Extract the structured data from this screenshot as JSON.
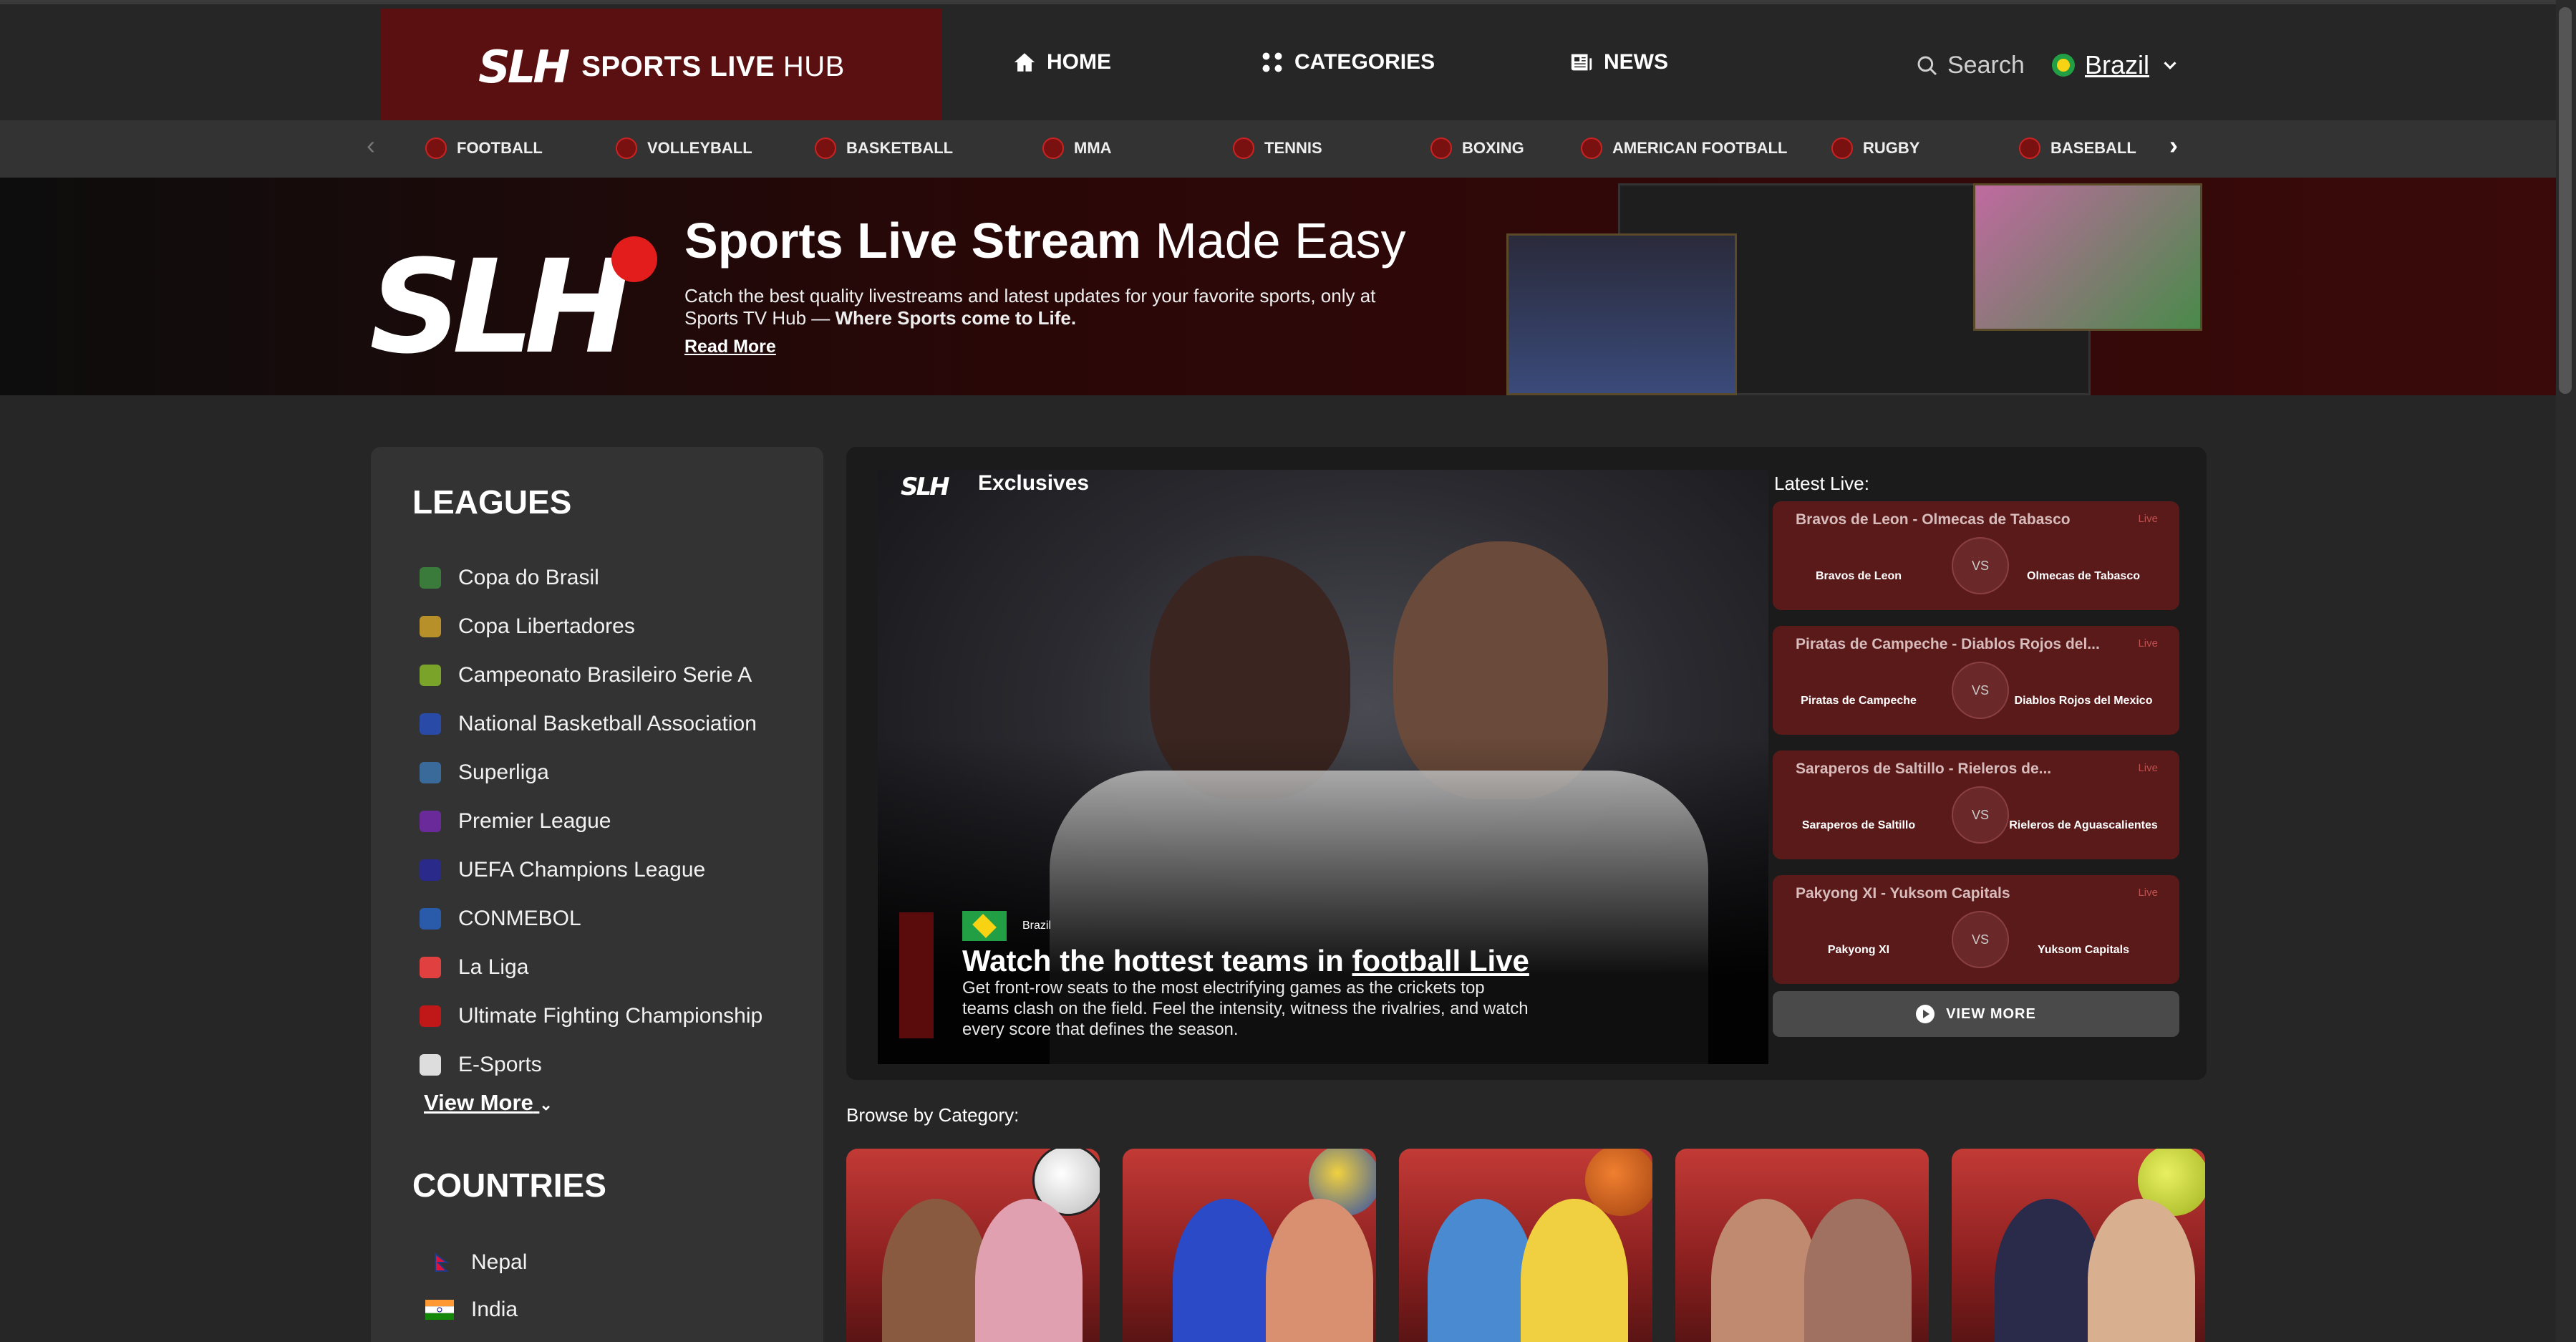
{
  "header": {
    "logo_mark": "SLH",
    "logo_brand": "SPORTS LIVE",
    "logo_brand_light": "HUB",
    "nav": [
      {
        "label": "HOME",
        "icon": "home-icon"
      },
      {
        "label": "CATEGORIES",
        "icon": "grid-icon"
      },
      {
        "label": "NEWS",
        "icon": "newspaper-icon"
      }
    ],
    "search_label": "Search",
    "country": "Brazil"
  },
  "sports": [
    "FOOTBALL",
    "VOLLEYBALL",
    "BASKETBALL",
    "MMA",
    "TENNIS",
    "BOXING",
    "AMERICAN FOOTBALL",
    "RUGBY",
    "BASEBALL"
  ],
  "banner": {
    "title_bold": "Sports Live Stream",
    "title_light": "Made Easy",
    "desc": "Catch the best quality livestreams and latest updates for your favorite sports, only at Sports TV Hub —",
    "desc_bold": "Where Sports come to Life.",
    "link": "Read More"
  },
  "sidebar": {
    "leagues_heading": "LEAGUES",
    "leagues": [
      {
        "name": "Copa do Brasil",
        "color": "#3a7a3a"
      },
      {
        "name": "Copa Libertadores",
        "color": "#b8902a"
      },
      {
        "name": "Campeonato Brasileiro Serie A",
        "color": "#7aa32a"
      },
      {
        "name": "National Basketball Association",
        "color": "#2a4aa8"
      },
      {
        "name": "Superliga",
        "color": "#3a6a9a"
      },
      {
        "name": "Premier League",
        "color": "#6a2a9a"
      },
      {
        "name": "UEFA Champions League",
        "color": "#2a2a8a"
      },
      {
        "name": "CONMEBOL",
        "color": "#2a5aaa"
      },
      {
        "name": "La Liga",
        "color": "#e04040"
      },
      {
        "name": "Ultimate Fighting Championship",
        "color": "#c01818"
      },
      {
        "name": "E-Sports",
        "color": "#dddddd"
      }
    ],
    "view_more": "View More",
    "countries_heading": "COUNTRIES",
    "countries": [
      "Nepal",
      "India"
    ]
  },
  "exclusives": {
    "logo": "SLH",
    "label": "Exclusives",
    "country": "Brazil",
    "title_prefix": "Watch the hottest teams in",
    "title_link": "football Live",
    "desc": "Get front-row seats to the most electrifying games as the crickets top teams clash on the field. Feel the intensity, witness the rivalries, and watch every score that defines the season."
  },
  "latest": {
    "label": "Latest Live:",
    "live_tag": "Live",
    "vs": "VS",
    "matches": [
      {
        "title": "Bravos de Leon - Olmecas de Tabasco",
        "team1": "Bravos de Leon",
        "team2": "Olmecas de Tabasco"
      },
      {
        "title": "Piratas de Campeche - Diablos Rojos del...",
        "team1": "Piratas de Campeche",
        "team2": "Diablos Rojos del Mexico"
      },
      {
        "title": "Saraperos de Saltillo - Rieleros de...",
        "team1": "Saraperos de Saltillo",
        "team2": "Rieleros de Aguascalientes"
      },
      {
        "title": "Pakyong XI - Yuksom Capitals",
        "team1": "Pakyong XI",
        "team2": "Yuksom Capitals"
      }
    ],
    "view_more": "VIEW MORE"
  },
  "browse_label": "Browse by Category:"
}
